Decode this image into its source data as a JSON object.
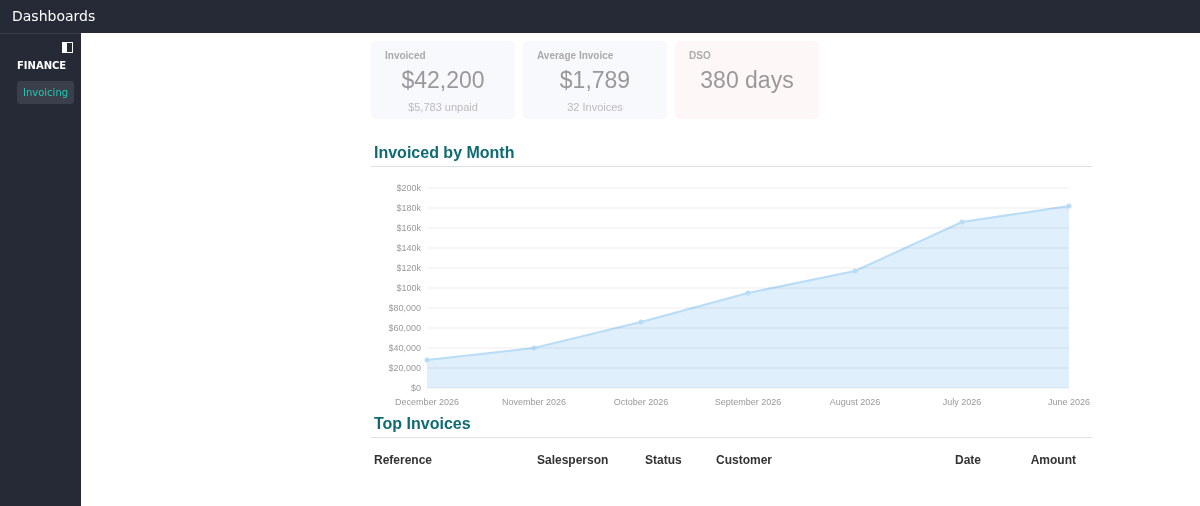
{
  "topbar": {
    "title": "Dashboards"
  },
  "sidebar": {
    "section": "FINANCE",
    "items": [
      {
        "label": "Invoicing",
        "selected": true
      }
    ]
  },
  "cards": [
    {
      "label": "Invoiced",
      "value": "$42,200",
      "sub": "$5,783 unpaid",
      "color": "#f8f9fd"
    },
    {
      "label": "Average Invoice",
      "value": "$1,789",
      "sub": "32 Invoices",
      "color": "#f8f9fd"
    },
    {
      "label": "DSO",
      "value": "380 days",
      "color": "#fdf8f7"
    }
  ],
  "chart_section": {
    "title": "Invoiced by Month",
    "chart_data": {
      "type": "area",
      "categories": [
        "December 2026",
        "November 2026",
        "October 2026",
        "September 2026",
        "August 2026",
        "July 2026",
        "June 2026"
      ],
      "grid": true,
      "series": [
        {
          "color": "#b9dcf7",
          "values": [
            28000,
            40000,
            66000,
            95000,
            117000,
            166000,
            182000
          ]
        }
      ],
      "ylim": [
        0,
        200000
      ],
      "yticks": [
        {
          "value": 0,
          "label": "$0"
        },
        {
          "value": 20000,
          "label": "$20,000"
        },
        {
          "value": 40000,
          "label": "$40,000"
        },
        {
          "value": 60000,
          "label": "$60,000"
        },
        {
          "value": 80000,
          "label": "$80,000"
        },
        {
          "value": 100000,
          "label": "$100k"
        },
        {
          "value": 120000,
          "label": "$120k"
        },
        {
          "value": 140000,
          "label": "$140k"
        },
        {
          "value": 160000,
          "label": "$160k"
        },
        {
          "value": 180000,
          "label": "$180k"
        },
        {
          "value": 200000,
          "label": "$200k"
        }
      ]
    }
  },
  "table": {
    "title": "Top Invoices",
    "columns": [
      "Reference",
      "Salesperson",
      "Status",
      "Customer",
      "Date",
      "Amount"
    ]
  }
}
